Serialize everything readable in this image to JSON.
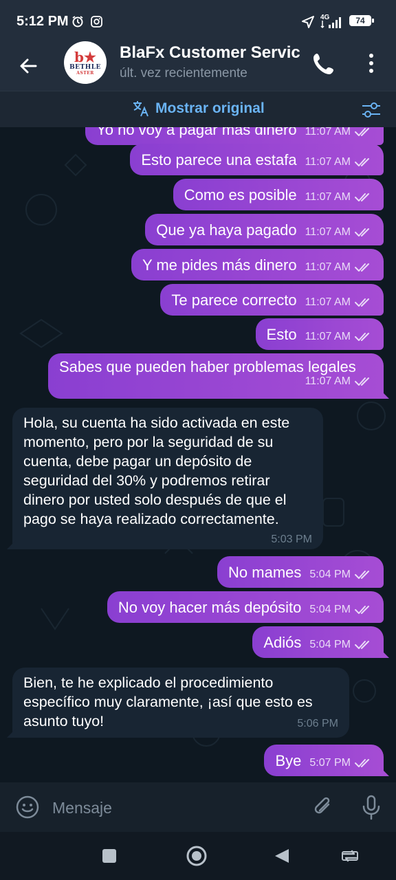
{
  "status_bar": {
    "time": "5:12 PM",
    "battery": "74",
    "network": "4G"
  },
  "header": {
    "contact_name": "BlaFx Customer Servic",
    "last_seen": "últ. vez recientemente",
    "avatar_text": "BETHLE",
    "avatar_subtext": "ASTER"
  },
  "translate_bar": {
    "label": "Mostrar original"
  },
  "messages": [
    {
      "dir": "out",
      "text": "Yo no voy a pagar más dinero",
      "time": "11:07 AM"
    },
    {
      "dir": "out",
      "text": "Esto parece una estafa",
      "time": "11:07 AM"
    },
    {
      "dir": "out",
      "text": "Como es posible",
      "time": "11:07 AM"
    },
    {
      "dir": "out",
      "text": "Que ya haya pagado",
      "time": "11:07 AM"
    },
    {
      "dir": "out",
      "text": "Y me pides más dinero",
      "time": "11:07 AM"
    },
    {
      "dir": "out",
      "text": "Te parece correcto",
      "time": "11:07 AM"
    },
    {
      "dir": "out",
      "text": "Esto",
      "time": "11:07 AM"
    },
    {
      "dir": "out",
      "text": "Sabes que pueden haber problemas legales",
      "time": "11:07 AM"
    },
    {
      "dir": "in",
      "text": "Hola, su cuenta ha sido activada en este momento, pero por la seguridad de su cuenta, debe pagar un depósito de seguridad del 30% y podremos retirar dinero por usted solo después de que el pago se haya realizado correctamente.",
      "time": "5:03 PM"
    },
    {
      "dir": "out",
      "text": "No mames",
      "time": "5:04 PM"
    },
    {
      "dir": "out",
      "text": "No voy hacer más depósito",
      "time": "5:04 PM"
    },
    {
      "dir": "out",
      "text": "Adiós",
      "time": "5:04 PM"
    },
    {
      "dir": "in",
      "text": "Bien, te he explicado el procedimiento específico muy claramente, ¡así que esto es asunto tuyo!",
      "time": "5:06 PM"
    },
    {
      "dir": "out",
      "text": "Bye",
      "time": "5:07 PM"
    }
  ],
  "composer": {
    "placeholder": "Mensaje"
  },
  "colors": {
    "outgoing_bubble": "#9b47d3",
    "incoming_bubble": "#182533",
    "accent": "#6ab3f3",
    "header_bg": "#232e3c"
  },
  "icons": [
    "back-arrow-icon",
    "phone-icon",
    "more-vert-icon",
    "translate-icon",
    "tune-icon",
    "double-check-icon",
    "emoji-icon",
    "attach-icon",
    "mic-icon",
    "nav-recents-icon",
    "nav-home-icon",
    "nav-back-icon",
    "nav-rotate-icon"
  ]
}
